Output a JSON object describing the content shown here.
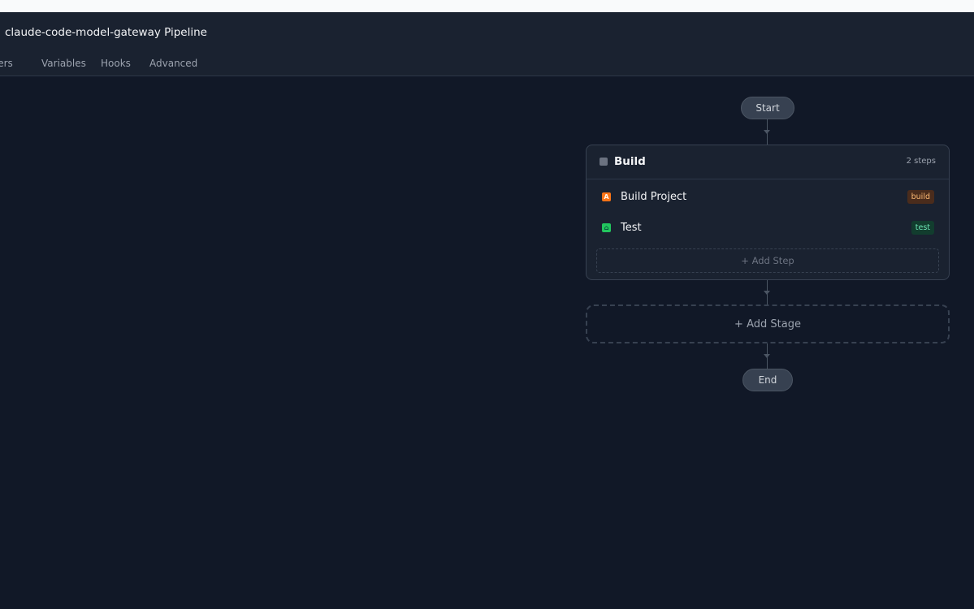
{
  "header": {
    "title": "claude-code-model-gateway Pipeline",
    "tabs": [
      {
        "label": "ggers"
      },
      {
        "label": "Variables"
      },
      {
        "label": "Hooks"
      },
      {
        "label": "Advanced"
      }
    ]
  },
  "flow": {
    "start_label": "Start",
    "end_label": "End",
    "stage": {
      "name": "Build",
      "step_count": "2 steps",
      "steps": [
        {
          "name": "Build Project",
          "badge": "build",
          "icon": "build-step-icon"
        },
        {
          "name": "Test",
          "badge": "test",
          "icon": "test-step-icon"
        }
      ],
      "add_step_label": "+ Add Step"
    },
    "add_stage_label": "+ Add Stage"
  },
  "colors": {
    "background": "#111827",
    "panel": "#1a2230",
    "build_accent": "#f97316",
    "test_accent": "#22c55e"
  }
}
